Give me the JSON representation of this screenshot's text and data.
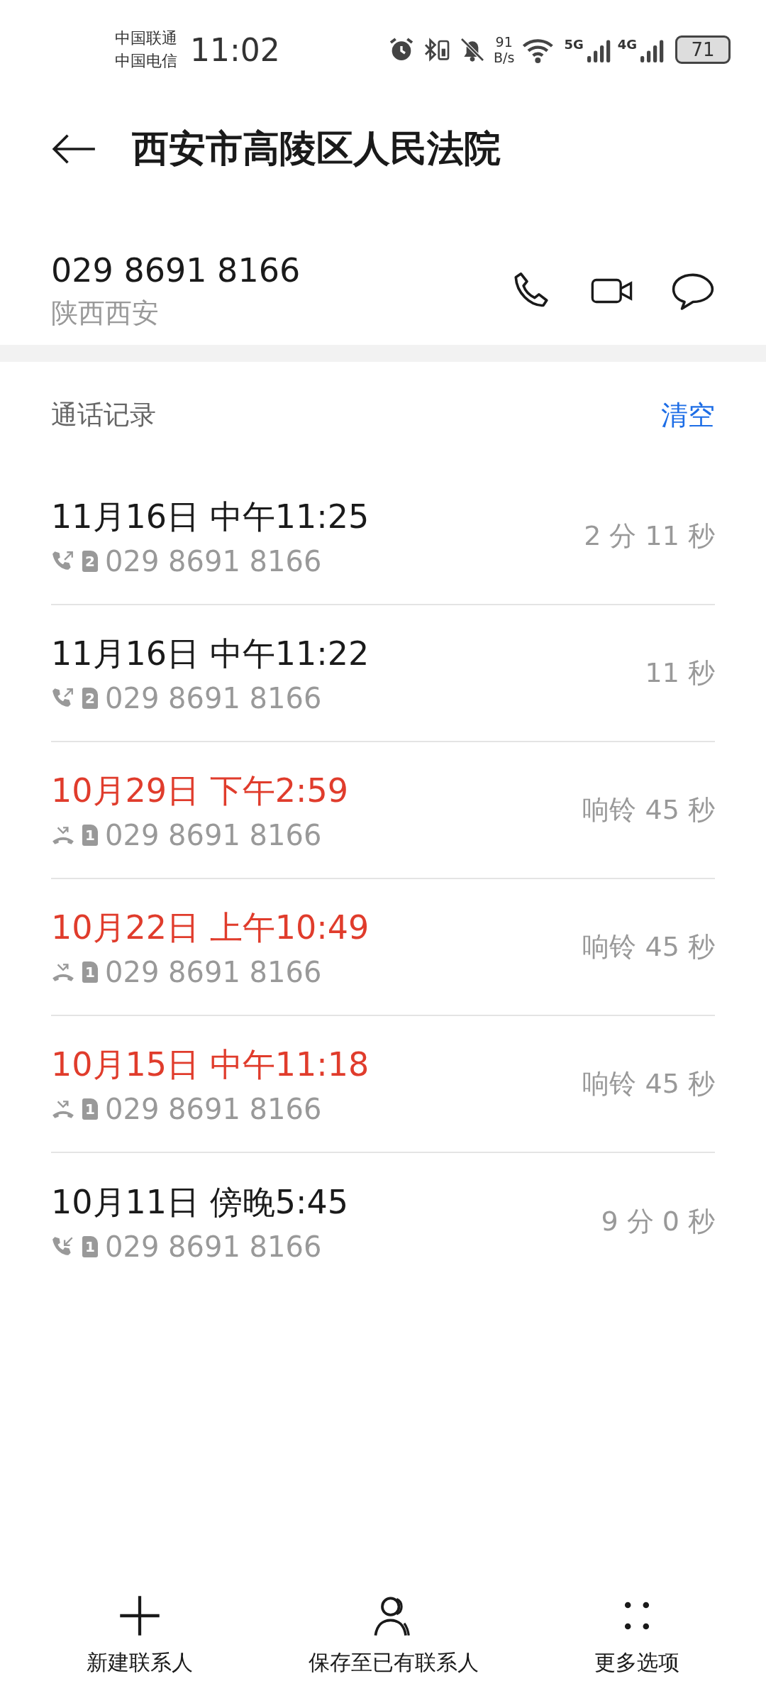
{
  "status_bar": {
    "carriers": [
      "中国联通",
      "中国电信"
    ],
    "time": "11:02",
    "speed_value": "91",
    "speed_unit": "B/s",
    "networks": [
      "5G",
      "4G"
    ],
    "battery": "71"
  },
  "header": {
    "title": "西安市高陵区人民法院"
  },
  "contact": {
    "number": "029 8691 8166",
    "location": "陕西西安"
  },
  "call_log": {
    "title": "通话记录",
    "clear": "清空",
    "rows": [
      {
        "kind": "outgoing",
        "date": "11月16日 中午11:25",
        "sim": "2",
        "number": "029 8691 8166",
        "duration": "2 分 11 秒"
      },
      {
        "kind": "outgoing",
        "date": "11月16日 中午11:22",
        "sim": "2",
        "number": "029 8691 8166",
        "duration": "11 秒"
      },
      {
        "kind": "missed",
        "date": "10月29日 下午2:59",
        "sim": "1",
        "number": "029 8691 8166",
        "duration": "响铃 45 秒"
      },
      {
        "kind": "missed",
        "date": "10月22日 上午10:49",
        "sim": "1",
        "number": "029 8691 8166",
        "duration": "响铃 45 秒"
      },
      {
        "kind": "missed",
        "date": "10月15日 中午11:18",
        "sim": "1",
        "number": "029 8691 8166",
        "duration": "响铃 45 秒"
      },
      {
        "kind": "incoming",
        "date": "10月11日 傍晚5:45",
        "sim": "1",
        "number": "029 8691 8166",
        "duration": "9 分 0 秒"
      }
    ]
  },
  "bottom_bar": [
    {
      "kind": "add",
      "label": "新建联系人"
    },
    {
      "kind": "person",
      "label": "保存至已有联系人"
    },
    {
      "kind": "more",
      "label": "更多选项"
    }
  ]
}
